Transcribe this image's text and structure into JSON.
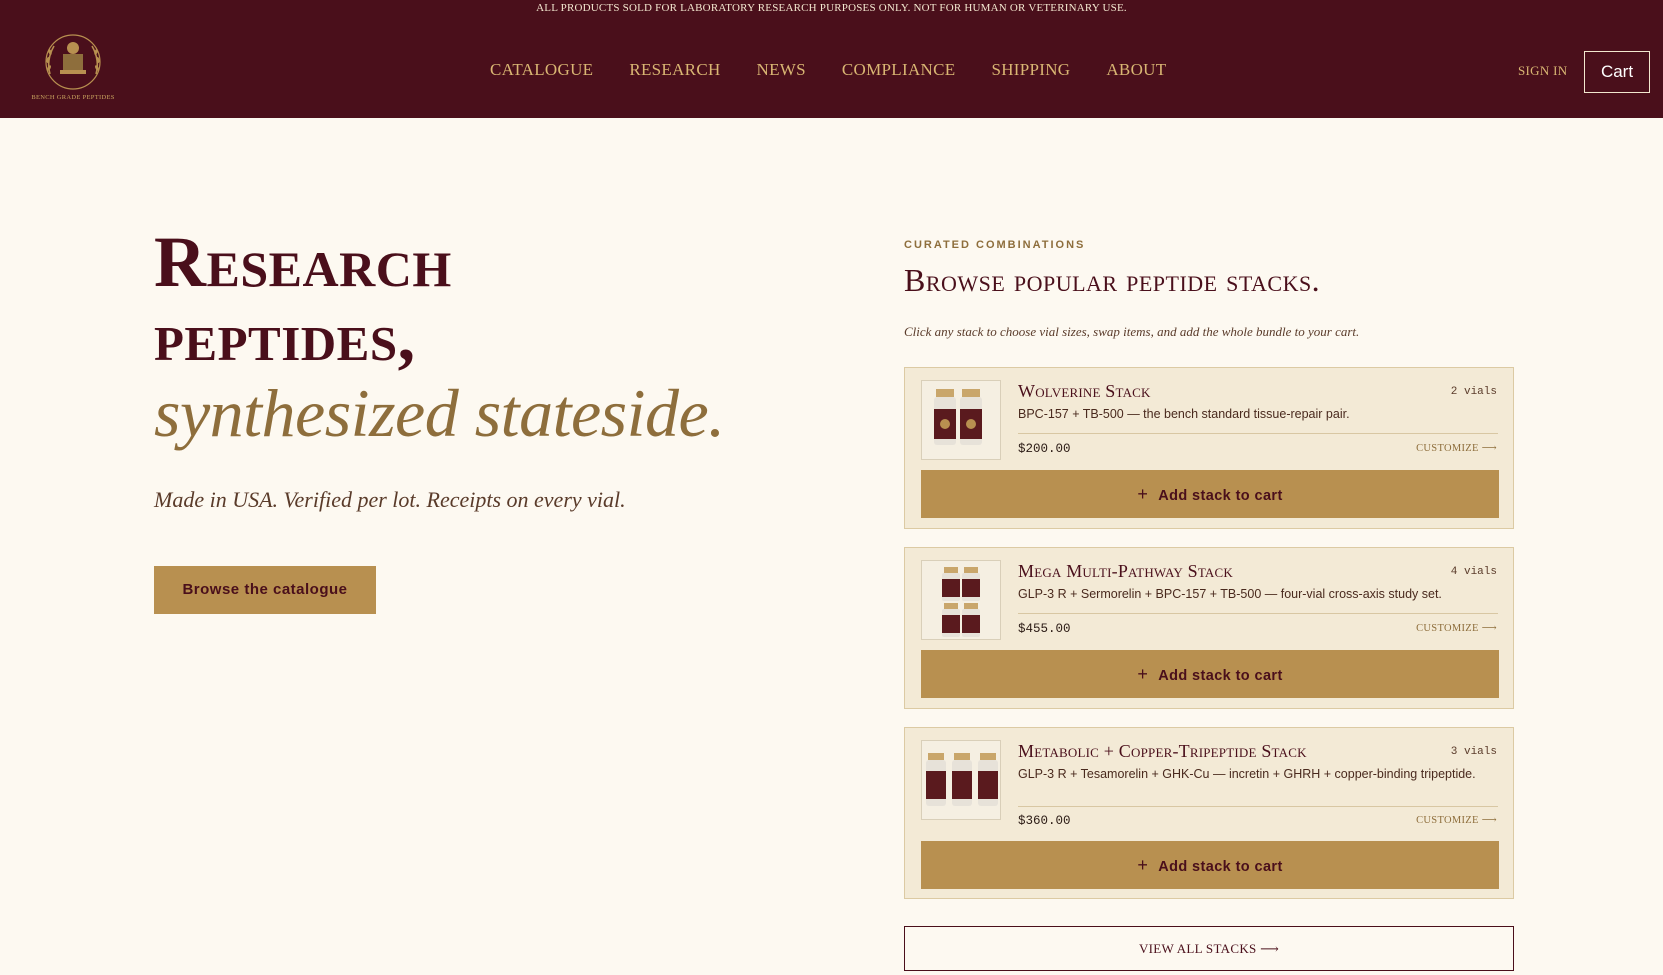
{
  "header": {
    "announcement": "ALL PRODUCTS SOLD FOR LABORATORY RESEARCH PURPOSES ONLY. NOT FOR HUMAN OR VETERINARY USE.",
    "logo_text": "BENCH GRADE PEPTIDES",
    "nav": [
      "CATALOGUE",
      "RESEARCH",
      "NEWS",
      "COMPLIANCE",
      "SHIPPING",
      "ABOUT"
    ],
    "sign_in": "SIGN IN",
    "cart": "Cart"
  },
  "hero": {
    "title_line1": "Research",
    "title_line2": "peptides,",
    "title_italic": "synthesized stateside.",
    "subtitle": "Made in USA. Verified per lot. Receipts on every vial.",
    "cta": "Browse the catalogue"
  },
  "stacks_section": {
    "eyebrow": "CURATED COMBINATIONS",
    "title": "Browse popular peptide stacks.",
    "description": "Click any stack to choose vial sizes, swap items, and add the whole bundle to your cart.",
    "customize_label": "CUSTOMIZE ⟶",
    "add_label": "Add stack to cart",
    "view_all": "VIEW ALL STACKS ⟶",
    "stacks": [
      {
        "name": "Wolverine Stack",
        "count": "2 vials",
        "description": "BPC-157 + TB-500 — the bench standard tissue-repair pair.",
        "price": "$200.00"
      },
      {
        "name": "Mega Multi-Pathway Stack",
        "count": "4 vials",
        "description": "GLP-3 R + Sermorelin + BPC-157 + TB-500 — four-vial cross-axis study set.",
        "price": "$455.00"
      },
      {
        "name": "Metabolic + Copper-Tripeptide Stack",
        "count": "3 vials",
        "description": "GLP-3 R + Tesamorelin + GHK-Cu — incretin + GHRH + copper-binding tripeptide.",
        "price": "$360.00"
      }
    ]
  },
  "colors": {
    "brand_maroon": "#4a0f1b",
    "gold": "#b89050",
    "cream": "#fdf9f1",
    "card": "#f3ead6"
  }
}
